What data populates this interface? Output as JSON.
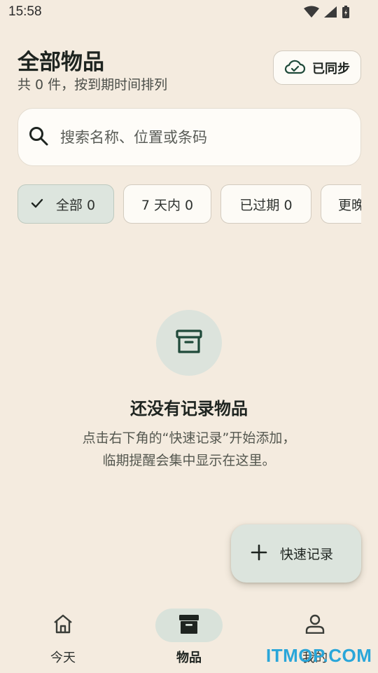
{
  "status_bar": {
    "time": "15:58"
  },
  "header": {
    "title": "全部物品",
    "subtitle": "共 0 件，按到期时间排列",
    "sync_label": "已同步"
  },
  "search": {
    "placeholder": "搜索名称、位置或条码",
    "value": ""
  },
  "filters": [
    {
      "label": "全部 0",
      "selected": true
    },
    {
      "label": "7 天内 0",
      "selected": false
    },
    {
      "label": "已过期 0",
      "selected": false
    },
    {
      "label": "更晚",
      "selected": false
    }
  ],
  "empty_state": {
    "title": "还没有记录物品",
    "line1": "点击右下角的“快速记录”开始添加，",
    "line2": "临期提醒会集中显示在这里。"
  },
  "fab": {
    "label": "快速记录"
  },
  "bottom_nav": [
    {
      "label": "今天",
      "icon": "home-icon",
      "active": false
    },
    {
      "label": "物品",
      "icon": "archive-icon",
      "active": true
    },
    {
      "label": "我的",
      "icon": "person-icon",
      "active": false
    }
  ],
  "watermark": "ITMOP.COM",
  "colors": {
    "background": "#F4EBDF",
    "accent_green": "#1F4A3A",
    "selected_tint": "#DDE5DE"
  }
}
